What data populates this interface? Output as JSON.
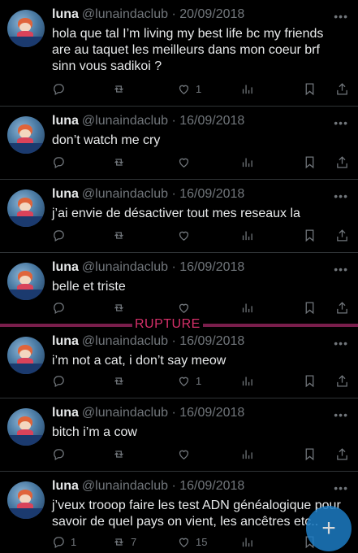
{
  "tweets": [
    {
      "name": "luna",
      "handle": "@lunaindaclub",
      "date": "· 20/09/2018",
      "text": "hola que tal I’m living my best life bc my friends are au taquet les meilleurs dans mon coeur brf sinn vous sadikoi ?",
      "reply_count": "",
      "retweet_count": "",
      "like_count": "1"
    },
    {
      "name": "luna",
      "handle": "@lunaindaclub",
      "date": "· 16/09/2018",
      "text": "don’t watch me cry",
      "reply_count": "",
      "retweet_count": "",
      "like_count": ""
    },
    {
      "name": "luna",
      "handle": "@lunaindaclub",
      "date": "· 16/09/2018",
      "text": "j’ai envie de désactiver tout mes reseaux la",
      "reply_count": "",
      "retweet_count": "",
      "like_count": ""
    },
    {
      "name": "luna",
      "handle": "@lunaindaclub",
      "date": "· 16/09/2018",
      "text": "belle et triste",
      "reply_count": "",
      "retweet_count": "",
      "like_count": ""
    },
    {
      "name": "luna",
      "handle": "@lunaindaclub",
      "date": "· 16/09/2018",
      "text": "i’m not a cat, i don’t say meow",
      "reply_count": "",
      "retweet_count": "",
      "like_count": "1"
    },
    {
      "name": "luna",
      "handle": "@lunaindaclub",
      "date": "· 16/09/2018",
      "text": "bitch i’m a cow",
      "reply_count": "",
      "retweet_count": "",
      "like_count": ""
    },
    {
      "name": "luna",
      "handle": "@lunaindaclub",
      "date": "· 16/09/2018",
      "text": "j’veux trooop faire les test ADN généalogique pour savoir de quel pays on vient, les ancêtres etc..",
      "reply_count": "1",
      "retweet_count": "7",
      "like_count": "15"
    }
  ],
  "overlay": {
    "rupture_label": "RUPTURE"
  },
  "fab": {
    "icon": "plus-icon",
    "label": "+"
  },
  "colors": {
    "background": "#000000",
    "text": "#e7e9ea",
    "muted": "#71767b",
    "rupture": "#d6306a",
    "fab": "#1d7cc4"
  }
}
